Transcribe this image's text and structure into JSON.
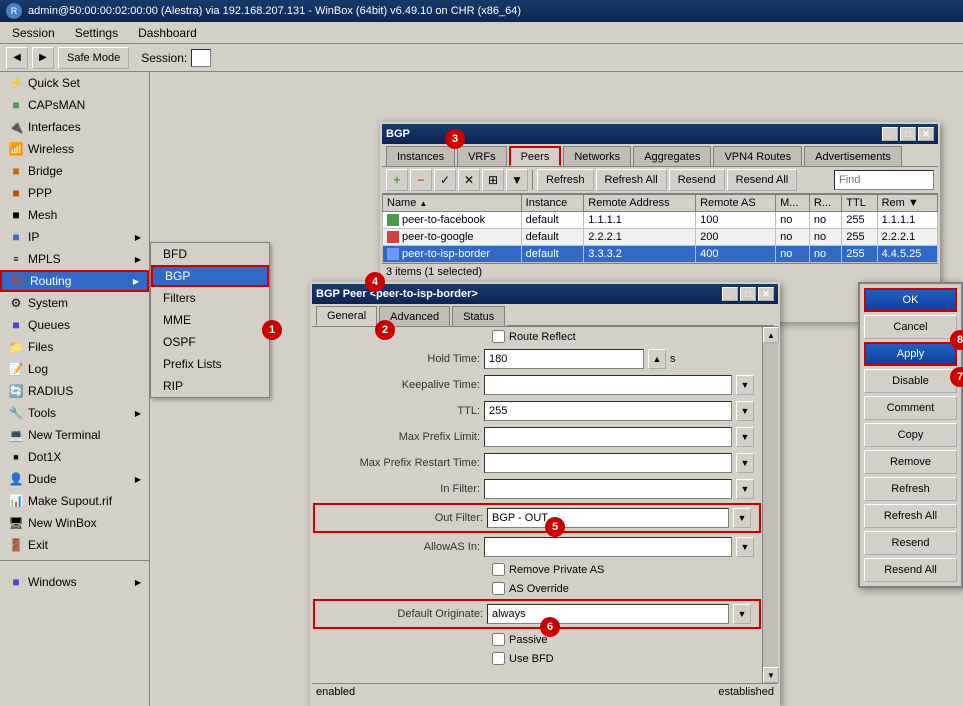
{
  "titlebar": {
    "text": "admin@50:00:00:02:00:00 (Alestra) via 192.168.207.131 - WinBox (64bit) v6.49.10 on CHR (x86_64)"
  },
  "menubar": {
    "items": [
      "Session",
      "Settings",
      "Dashboard"
    ]
  },
  "toolbar": {
    "safe_mode": "Safe Mode",
    "session_label": "Session:"
  },
  "sidebar": {
    "items": [
      {
        "label": "Quick Set",
        "icon": "⚡"
      },
      {
        "label": "CAPsMAN",
        "icon": "📡"
      },
      {
        "label": "Interfaces",
        "icon": "🔌"
      },
      {
        "label": "Wireless",
        "icon": "📶"
      },
      {
        "label": "Bridge",
        "icon": "🌉"
      },
      {
        "label": "PPP",
        "icon": "🔗"
      },
      {
        "label": "Mesh",
        "icon": "🕸"
      },
      {
        "label": "IP",
        "icon": "🌐",
        "has_arrow": true
      },
      {
        "label": "MPLS",
        "icon": "📦",
        "has_arrow": true
      },
      {
        "label": "Routing",
        "icon": "🗺",
        "has_arrow": true,
        "active": true
      },
      {
        "label": "System",
        "icon": "⚙"
      },
      {
        "label": "Queues",
        "icon": "📋"
      },
      {
        "label": "Files",
        "icon": "📁"
      },
      {
        "label": "Log",
        "icon": "📝"
      },
      {
        "label": "RADIUS",
        "icon": "🔄"
      },
      {
        "label": "Tools",
        "icon": "🔧",
        "has_arrow": true
      },
      {
        "label": "New Terminal",
        "icon": "💻"
      },
      {
        "label": "Dot1X",
        "icon": "🔐"
      },
      {
        "label": "Dude",
        "icon": "👤",
        "has_arrow": true
      },
      {
        "label": "Make Supout.rif",
        "icon": "📊"
      },
      {
        "label": "New WinBox",
        "icon": "🖥"
      },
      {
        "label": "Exit",
        "icon": "🚪"
      }
    ],
    "windows_label": "Windows",
    "windows_items": []
  },
  "routing_submenu": {
    "items": [
      "BFD",
      "BGP",
      "Filters",
      "MME",
      "OSPF",
      "Prefix Lists",
      "RIP"
    ],
    "highlighted": "BGP"
  },
  "bgp_window": {
    "title": "BGP",
    "tabs": [
      "Instances",
      "VRFs",
      "Peers",
      "Networks",
      "Aggregates",
      "VPN4 Routes",
      "Advertisements"
    ],
    "active_tab": "Peers",
    "toolbar": {
      "buttons": [
        "Refresh",
        "Refresh All",
        "Resend",
        "Resend All"
      ],
      "find_placeholder": "Find"
    },
    "columns": [
      "Name",
      "Instance",
      "Remote Address",
      "Remote AS",
      "M...",
      "R...",
      "TTL",
      "Rem"
    ],
    "rows": [
      {
        "name": "peer-to-facebook",
        "instance": "default",
        "remote_address": "1.1.1.1",
        "remote_as": "100",
        "m": "no",
        "r": "no",
        "ttl": "255",
        "rem": "1.1.1.1"
      },
      {
        "name": "peer-to-google",
        "instance": "default",
        "remote_address": "2.2.2.1",
        "remote_as": "200",
        "m": "no",
        "r": "no",
        "ttl": "255",
        "rem": "2.2.2.1"
      },
      {
        "name": "peer-to-isp-border",
        "instance": "default",
        "remote_address": "3.3.3.2",
        "remote_as": "400",
        "m": "no",
        "r": "no",
        "ttl": "255",
        "rem": "4.4.5.25",
        "selected": true
      }
    ],
    "status": "3 items (1 selected)"
  },
  "bgp_peer_window": {
    "title": "BGP Peer <peer-to-isp-border>",
    "tabs": [
      "General",
      "Advanced",
      "Status"
    ],
    "active_tab": "General",
    "fields": {
      "route_reflect_label": "Route Reflect",
      "hold_time_label": "Hold Time:",
      "hold_time_value": "180",
      "keepalive_time_label": "Keepalive Time:",
      "ttl_label": "TTL:",
      "ttl_value": "255",
      "max_prefix_limit_label": "Max Prefix Limit:",
      "max_prefix_restart_label": "Max Prefix Restart Time:",
      "in_filter_label": "In Filter:",
      "out_filter_label": "Out Filter:",
      "out_filter_value": "BGP - OUT",
      "allowas_in_label": "AllowAS In:",
      "remove_private_as_label": "Remove Private AS",
      "as_override_label": "AS Override",
      "default_originate_label": "Default Originate:",
      "default_originate_value": "always",
      "passive_label": "Passive",
      "use_bfd_label": "Use BFD"
    },
    "status_left": "enabled",
    "status_right": "established"
  },
  "right_panel": {
    "buttons": [
      "OK",
      "Cancel",
      "Apply",
      "Disable",
      "Comment",
      "Copy",
      "Remove",
      "Refresh",
      "Refresh All",
      "Resend",
      "Resend All"
    ]
  },
  "callouts": [
    {
      "number": "1",
      "label": "Routing menu item"
    },
    {
      "number": "2",
      "label": "BGP submenu"
    },
    {
      "number": "3",
      "label": "Peers tab"
    },
    {
      "number": "4",
      "label": "peer-to-isp-border row"
    },
    {
      "number": "5",
      "label": "Out Filter field"
    },
    {
      "number": "6",
      "label": "Default Originate field"
    },
    {
      "number": "7",
      "label": "Apply button"
    },
    {
      "number": "8",
      "label": "OK button"
    }
  ]
}
